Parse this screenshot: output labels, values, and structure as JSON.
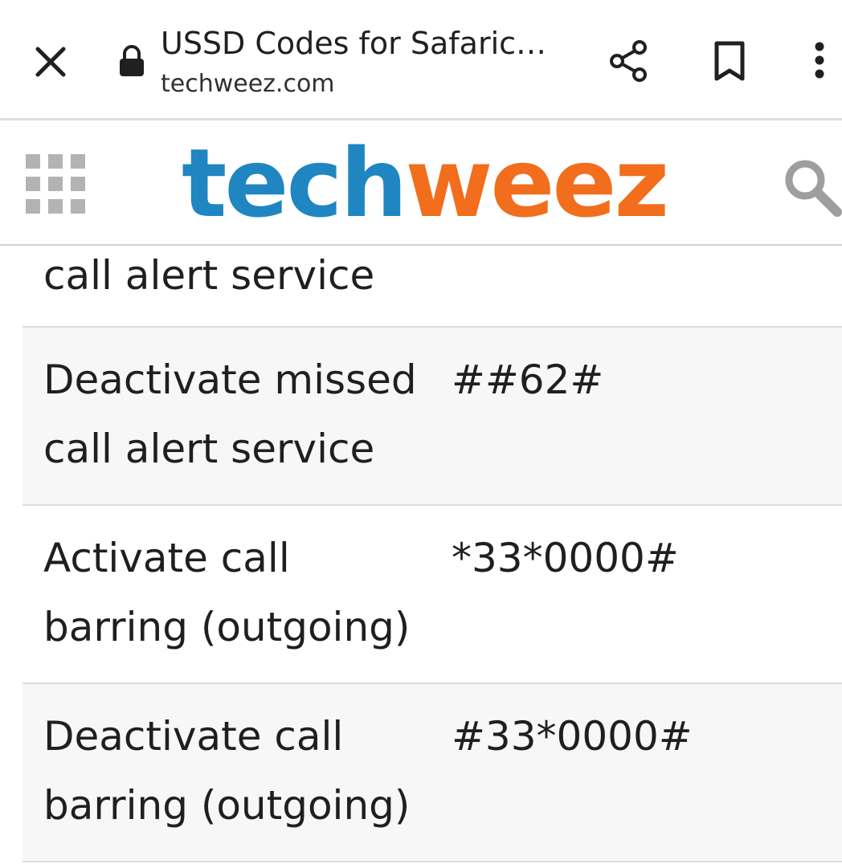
{
  "browser": {
    "title": "USSD Codes for Safaric…",
    "url": "techweez.com",
    "icons": {
      "close": "close-icon",
      "lock": "lock-icon",
      "share": "share-icon",
      "bookmark": "bookmark-icon",
      "more": "more-vert-icon"
    }
  },
  "site": {
    "logo_part1": "tech",
    "logo_part2": "weez",
    "logo_colors": {
      "tech": "#1f86c1",
      "weez": "#f26d1c"
    },
    "icons": {
      "menu": "grid-menu-icon",
      "search": "search-icon"
    }
  },
  "table": {
    "rows": [
      {
        "description": "call alert service",
        "code": ""
      },
      {
        "description": "Deactivate missed call alert service",
        "code": "##62#"
      },
      {
        "description": "Activate call barring (outgoing)",
        "code": "*33*0000#"
      },
      {
        "description": "Deactivate call barring (outgoing)",
        "code": "#33*0000#"
      }
    ]
  }
}
